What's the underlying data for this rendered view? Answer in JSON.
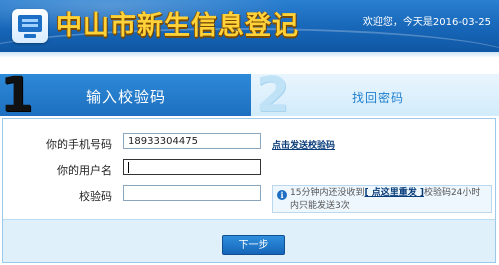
{
  "header": {
    "title": "中山市新生信息登记",
    "welcome": "欢迎您，今天是2016-03-25",
    "logo_icon": "computer-screen-icon",
    "title_color": "#ffd23a",
    "banner_color": "#1766b8"
  },
  "steps": [
    {
      "number": "1",
      "label": "输入校验码",
      "active": true
    },
    {
      "number": "2",
      "label": "找回密码",
      "active": false
    }
  ],
  "form": {
    "phone": {
      "label": "你的手机号码",
      "value": "18933304475"
    },
    "username": {
      "label": "你的用户名",
      "value": ""
    },
    "code": {
      "label": "校验码",
      "value": ""
    },
    "send_link": "点击发送校验码",
    "notice": {
      "icon": "info-icon",
      "text_before": "15分钟内还没收到",
      "link": "[ 点这里重发 ]",
      "text_after": "校验码24小时内只能发送3次"
    },
    "next_button": "下一步"
  },
  "colors": {
    "accent": "#1e6fc0",
    "panel_border": "#9cc9ea",
    "footer_bg": "#dff0fb"
  }
}
